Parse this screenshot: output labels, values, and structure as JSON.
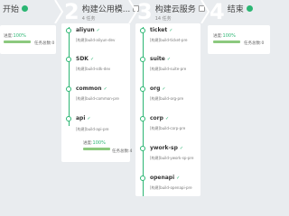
{
  "colors": {
    "success": "#2bb673",
    "bar": "#8cc97e",
    "background": "#e9ecef"
  },
  "stages": [
    {
      "num": "",
      "title": "开始",
      "sub": "",
      "status_icon": "success-dot-icon"
    },
    {
      "num": "2",
      "title": "构建公用模...",
      "sub": "4 任务",
      "status_icon": "checkbox-icon"
    },
    {
      "num": "3",
      "title": "构建云服务",
      "sub": "14 任务",
      "status_icon": "checkbox-icon"
    },
    {
      "num": "4",
      "title": "结束",
      "sub": "",
      "status_icon": "success-dot-icon"
    }
  ],
  "stage1": {
    "progress_label": "进度:",
    "progress_pct": "100%",
    "progress": 1.0,
    "task_label": "任务总数:0"
  },
  "stage2": {
    "jobs": [
      {
        "name": "aliyun",
        "desc": "[构建]build-aliyun-dev"
      },
      {
        "name": "SDK",
        "desc": "[构建]build-sdk-dev"
      },
      {
        "name": "common",
        "desc": "[构建]build-common-pre"
      },
      {
        "name": "api",
        "desc": "[构建]build-api-pre"
      }
    ],
    "progress_label": "进度:",
    "progress_pct": "100%",
    "progress": 1.0,
    "task_label": "任务总数:4"
  },
  "stage3": {
    "jobs": [
      {
        "name": "ticket",
        "desc": "[构建]build-ticket-pre"
      },
      {
        "name": "suite",
        "desc": "[构建]build-suite-pre"
      },
      {
        "name": "org",
        "desc": "[构建]build-org-pre"
      },
      {
        "name": "corp",
        "desc": "[构建]build-corp-pre"
      },
      {
        "name": "ywork-sp",
        "desc": "[构建]build-ywork-sp-pre"
      },
      {
        "name": "openapi",
        "desc": "[构建]build-openapi-pre"
      }
    ]
  },
  "stage4": {
    "progress_label": "进度:",
    "progress_pct": "100%",
    "progress": 1.0,
    "task_label": "任务总数:0"
  },
  "check_mark": "✓"
}
